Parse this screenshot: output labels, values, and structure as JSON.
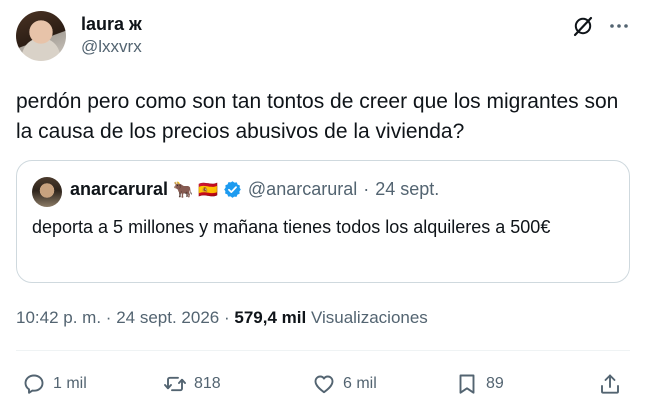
{
  "author": {
    "display_name": "laura",
    "name_glyph": "ж",
    "handle": "@lxxvrx"
  },
  "tweet": {
    "text": "perdón pero como son tan tontos de creer que los migrantes son la causa de los precios abusivos de la vivienda?"
  },
  "quoted_tweet": {
    "display_name": "anarcarural",
    "emojis": [
      "🐂",
      "🇪🇸"
    ],
    "handle": "@anarcarural",
    "separator": "·",
    "date": "24 sept.",
    "text": "deporta a 5 millones y mañana tienes todos los alquileres a 500€"
  },
  "meta": {
    "time": "10:42 p. m.",
    "separator": "·",
    "date": "24 sept. 2026",
    "separator2": "·",
    "views_count": "579,4 mil",
    "views_label": "Visualizaciones"
  },
  "actions": {
    "replies": "1 mil",
    "reposts": "818",
    "likes": "6 mil",
    "bookmarks": "89"
  },
  "colors": {
    "text_primary": "#0f1419",
    "text_secondary": "#536471",
    "border": "#cfd9de",
    "verified": "#1d9bf0"
  },
  "icons": [
    "grok-icon",
    "more-icon",
    "verified-icon",
    "reply-icon",
    "repost-icon",
    "like-icon",
    "bookmark-icon",
    "share-icon"
  ]
}
